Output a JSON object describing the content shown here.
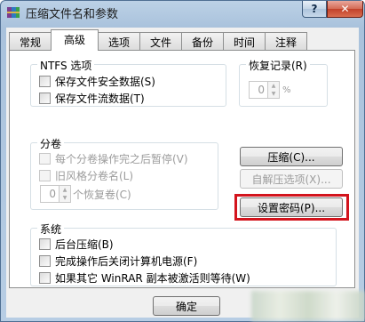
{
  "window": {
    "title": "压缩文件名和参数",
    "help_label": "?",
    "close_label": "✕"
  },
  "tabs": [
    "常规",
    "高级",
    "选项",
    "文件",
    "备份",
    "时间",
    "注释"
  ],
  "active_tab": "高级",
  "ntfs": {
    "legend": "NTFS 选项",
    "items": [
      {
        "label": "保存文件安全数据(S)",
        "checked": false
      },
      {
        "label": "保存文件流数据(T)",
        "checked": false
      }
    ]
  },
  "recovery": {
    "legend": "恢复记录(R)",
    "value": "0",
    "unit": "%"
  },
  "volumes": {
    "legend": "分卷",
    "items": [
      {
        "label": "每个分卷操作完之后暂停(V)",
        "checked": false,
        "enabled": false
      },
      {
        "label": "旧风格分卷名(L)",
        "checked": false,
        "enabled": false
      }
    ],
    "recovery_volumes_value": "0",
    "recovery_volumes_label": "个恢复卷(C)"
  },
  "buttons": {
    "compression": "压缩(C)...",
    "sfx_options": "自解压选项(X)...",
    "set_password": "设置密码(P)..."
  },
  "system": {
    "legend": "系统",
    "items": [
      {
        "label": "后台压缩(B)",
        "checked": false
      },
      {
        "label": "完成操作后关闭计算机电源(F)",
        "checked": false
      },
      {
        "label": "如果其它 WinRAR 副本被激活则等待(W)",
        "checked": false
      }
    ]
  },
  "footer": {
    "ok_label": "确定"
  },
  "colors": {
    "highlight": "#d3141d"
  }
}
